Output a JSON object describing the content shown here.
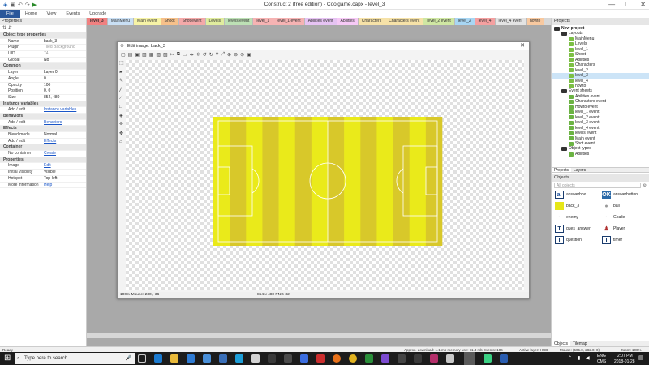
{
  "window": {
    "title": "Construct 2  (free edition) - Coolgame.capx - level_3",
    "controls": [
      "—",
      "☐",
      "✕"
    ]
  },
  "menu": {
    "file": "File",
    "items": [
      "Home",
      "View",
      "Events",
      "Upgrade"
    ]
  },
  "tabs": [
    "level_3",
    "MainMenu",
    "Main event",
    "Shoot",
    "Shot event",
    "Levels",
    "levels event",
    "level_1",
    "level_1 event",
    "Abilities event",
    "Abilities",
    "Characters",
    "Characters event",
    "level_2 event",
    "level_2",
    "level_4",
    "level_4 event",
    "howto"
  ],
  "tab_colors": [
    "#f08080",
    "#c9dff4",
    "#f6f3a6",
    "#f6c08a",
    "#f4a9a9",
    "#e0ec9e",
    "#bde0b5",
    "#f6b3b3",
    "#f6b3b3",
    "#e6c3f3",
    "#f6c9f6",
    "#f6e2a8",
    "#f6e2a8",
    "#cfe7a3",
    "#a8d6f3",
    "#f4a0a0",
    "#e3e3e3",
    "#f8c9a0"
  ],
  "left": {
    "header": "Properties",
    "rows": [
      {
        "type": "sec",
        "k": "Object type properties"
      },
      {
        "k": "Name",
        "v": "back_3"
      },
      {
        "k": "Plugin",
        "v": "Tiled Background",
        "style": "dim"
      },
      {
        "k": "UID",
        "v": "74",
        "style": "dim"
      },
      {
        "k": "Global",
        "v": "No"
      },
      {
        "type": "sec",
        "k": "Common"
      },
      {
        "k": "Layer",
        "v": "Layer 0"
      },
      {
        "k": "Angle",
        "v": "0"
      },
      {
        "k": "Opacity",
        "v": "100"
      },
      {
        "k": "Position",
        "v": "0, 0"
      },
      {
        "k": "Size",
        "v": "854, 480"
      },
      {
        "type": "sec",
        "k": "Instance variables"
      },
      {
        "k": "Add / edit",
        "v": "Instance variables",
        "style": "link"
      },
      {
        "type": "sec",
        "k": "Behaviors"
      },
      {
        "k": "Add / edit",
        "v": "Behaviors",
        "style": "link"
      },
      {
        "type": "sec",
        "k": "Effects"
      },
      {
        "k": "Blend mode",
        "v": "Normal"
      },
      {
        "k": "Add / edit",
        "v": "Effects",
        "style": "link"
      },
      {
        "type": "sec",
        "k": "Container"
      },
      {
        "k": "No container",
        "v": "Create",
        "style": "link"
      },
      {
        "type": "sec",
        "k": "Properties"
      },
      {
        "k": "Image",
        "v": "Edit",
        "style": "link"
      },
      {
        "k": "Initial visibility",
        "v": "Visible"
      },
      {
        "k": "Hotspot",
        "v": "Top-left"
      },
      {
        "k": "More information",
        "v": "Help",
        "style": "link"
      }
    ]
  },
  "dialog": {
    "title": "Edit image: back_3",
    "status_left": "100%  Mouse: 230, -36",
    "status_mid": "854 x 480  PNG-32"
  },
  "pitch": {
    "stripe_light": "#eaea1a",
    "stripe_dark": "#d8c82a"
  },
  "right": {
    "projects_header": "Projects",
    "tree": [
      {
        "d": 0,
        "t": "New project",
        "ic": "fold",
        "bold": true
      },
      {
        "d": 1,
        "t": "Layouts",
        "ic": "fold"
      },
      {
        "d": 2,
        "t": "MainMenu",
        "ic": "lay"
      },
      {
        "d": 2,
        "t": "Levels",
        "ic": "lay"
      },
      {
        "d": 2,
        "t": "level_1",
        "ic": "lay"
      },
      {
        "d": 2,
        "t": "Shoot",
        "ic": "lay"
      },
      {
        "d": 2,
        "t": "Abilities",
        "ic": "lay"
      },
      {
        "d": 2,
        "t": "Characters",
        "ic": "lay"
      },
      {
        "d": 2,
        "t": "level_2",
        "ic": "lay"
      },
      {
        "d": 2,
        "t": "level_3",
        "ic": "lay",
        "sel": true
      },
      {
        "d": 2,
        "t": "level_4",
        "ic": "lay"
      },
      {
        "d": 2,
        "t": "howto",
        "ic": "lay"
      },
      {
        "d": 1,
        "t": "Event sheets",
        "ic": "fold"
      },
      {
        "d": 2,
        "t": "Abilities event",
        "ic": "ev"
      },
      {
        "d": 2,
        "t": "Characters event",
        "ic": "ev"
      },
      {
        "d": 2,
        "t": "Howto event",
        "ic": "ev"
      },
      {
        "d": 2,
        "t": "level_1 event",
        "ic": "ev"
      },
      {
        "d": 2,
        "t": "level_2 event",
        "ic": "ev"
      },
      {
        "d": 2,
        "t": "level_3 event",
        "ic": "ev"
      },
      {
        "d": 2,
        "t": "level_4 event",
        "ic": "ev"
      },
      {
        "d": 2,
        "t": "levels event",
        "ic": "ev"
      },
      {
        "d": 2,
        "t": "Main event",
        "ic": "ev"
      },
      {
        "d": 2,
        "t": "Shot event",
        "ic": "ev"
      },
      {
        "d": 1,
        "t": "Object types",
        "ic": "fold"
      },
      {
        "d": 2,
        "t": "Abilities",
        "ic": "ev"
      }
    ],
    "subtabs": [
      "Projects",
      "Layers"
    ],
    "objects_header": "Objects",
    "objects_search": "All objects",
    "objects": [
      {
        "name": "answerbox",
        "icon": "a|",
        "bg": "#fff",
        "fg": "#1a4f9c"
      },
      {
        "name": "answerbutton",
        "icon": "OK",
        "bg": "#2b6aa8",
        "fg": "#fff"
      },
      {
        "name": "back_3",
        "icon": "",
        "bg": "#e6e617",
        "fg": "#000"
      },
      {
        "name": "ball",
        "icon": "●",
        "bg": "#fff",
        "fg": "#999"
      },
      {
        "name": "enemy",
        "icon": "·",
        "bg": "#fff",
        "fg": "#999"
      },
      {
        "name": "Goalie",
        "icon": "·",
        "bg": "#fff",
        "fg": "#999"
      },
      {
        "name": "gues_answer",
        "icon": "T",
        "bg": "#fff",
        "fg": "#1a3c6e"
      },
      {
        "name": "Player",
        "icon": "♟",
        "bg": "#fff",
        "fg": "#b03030"
      },
      {
        "name": "question",
        "icon": "T",
        "bg": "#fff",
        "fg": "#1a3c6e"
      },
      {
        "name": "timer",
        "icon": "T",
        "bg": "#fff",
        "fg": "#1a3c6e"
      }
    ],
    "bottom_tabs": [
      "Objects",
      "Tilemap"
    ]
  },
  "status": {
    "ready": "Ready",
    "download": "Approx. download: 1.1 mb  memory use: 11.4 mb  Events: 106",
    "active_layer": "Active layer: HUD",
    "mouse": "Mouse: (505.0, 282.0, 0)",
    "zoom": "Zoom: 100%"
  },
  "taskbar": {
    "search": "Type here to search",
    "lang": "ENG",
    "region": "CMS",
    "time": "2:07 PM",
    "date": "2018-01-28"
  }
}
